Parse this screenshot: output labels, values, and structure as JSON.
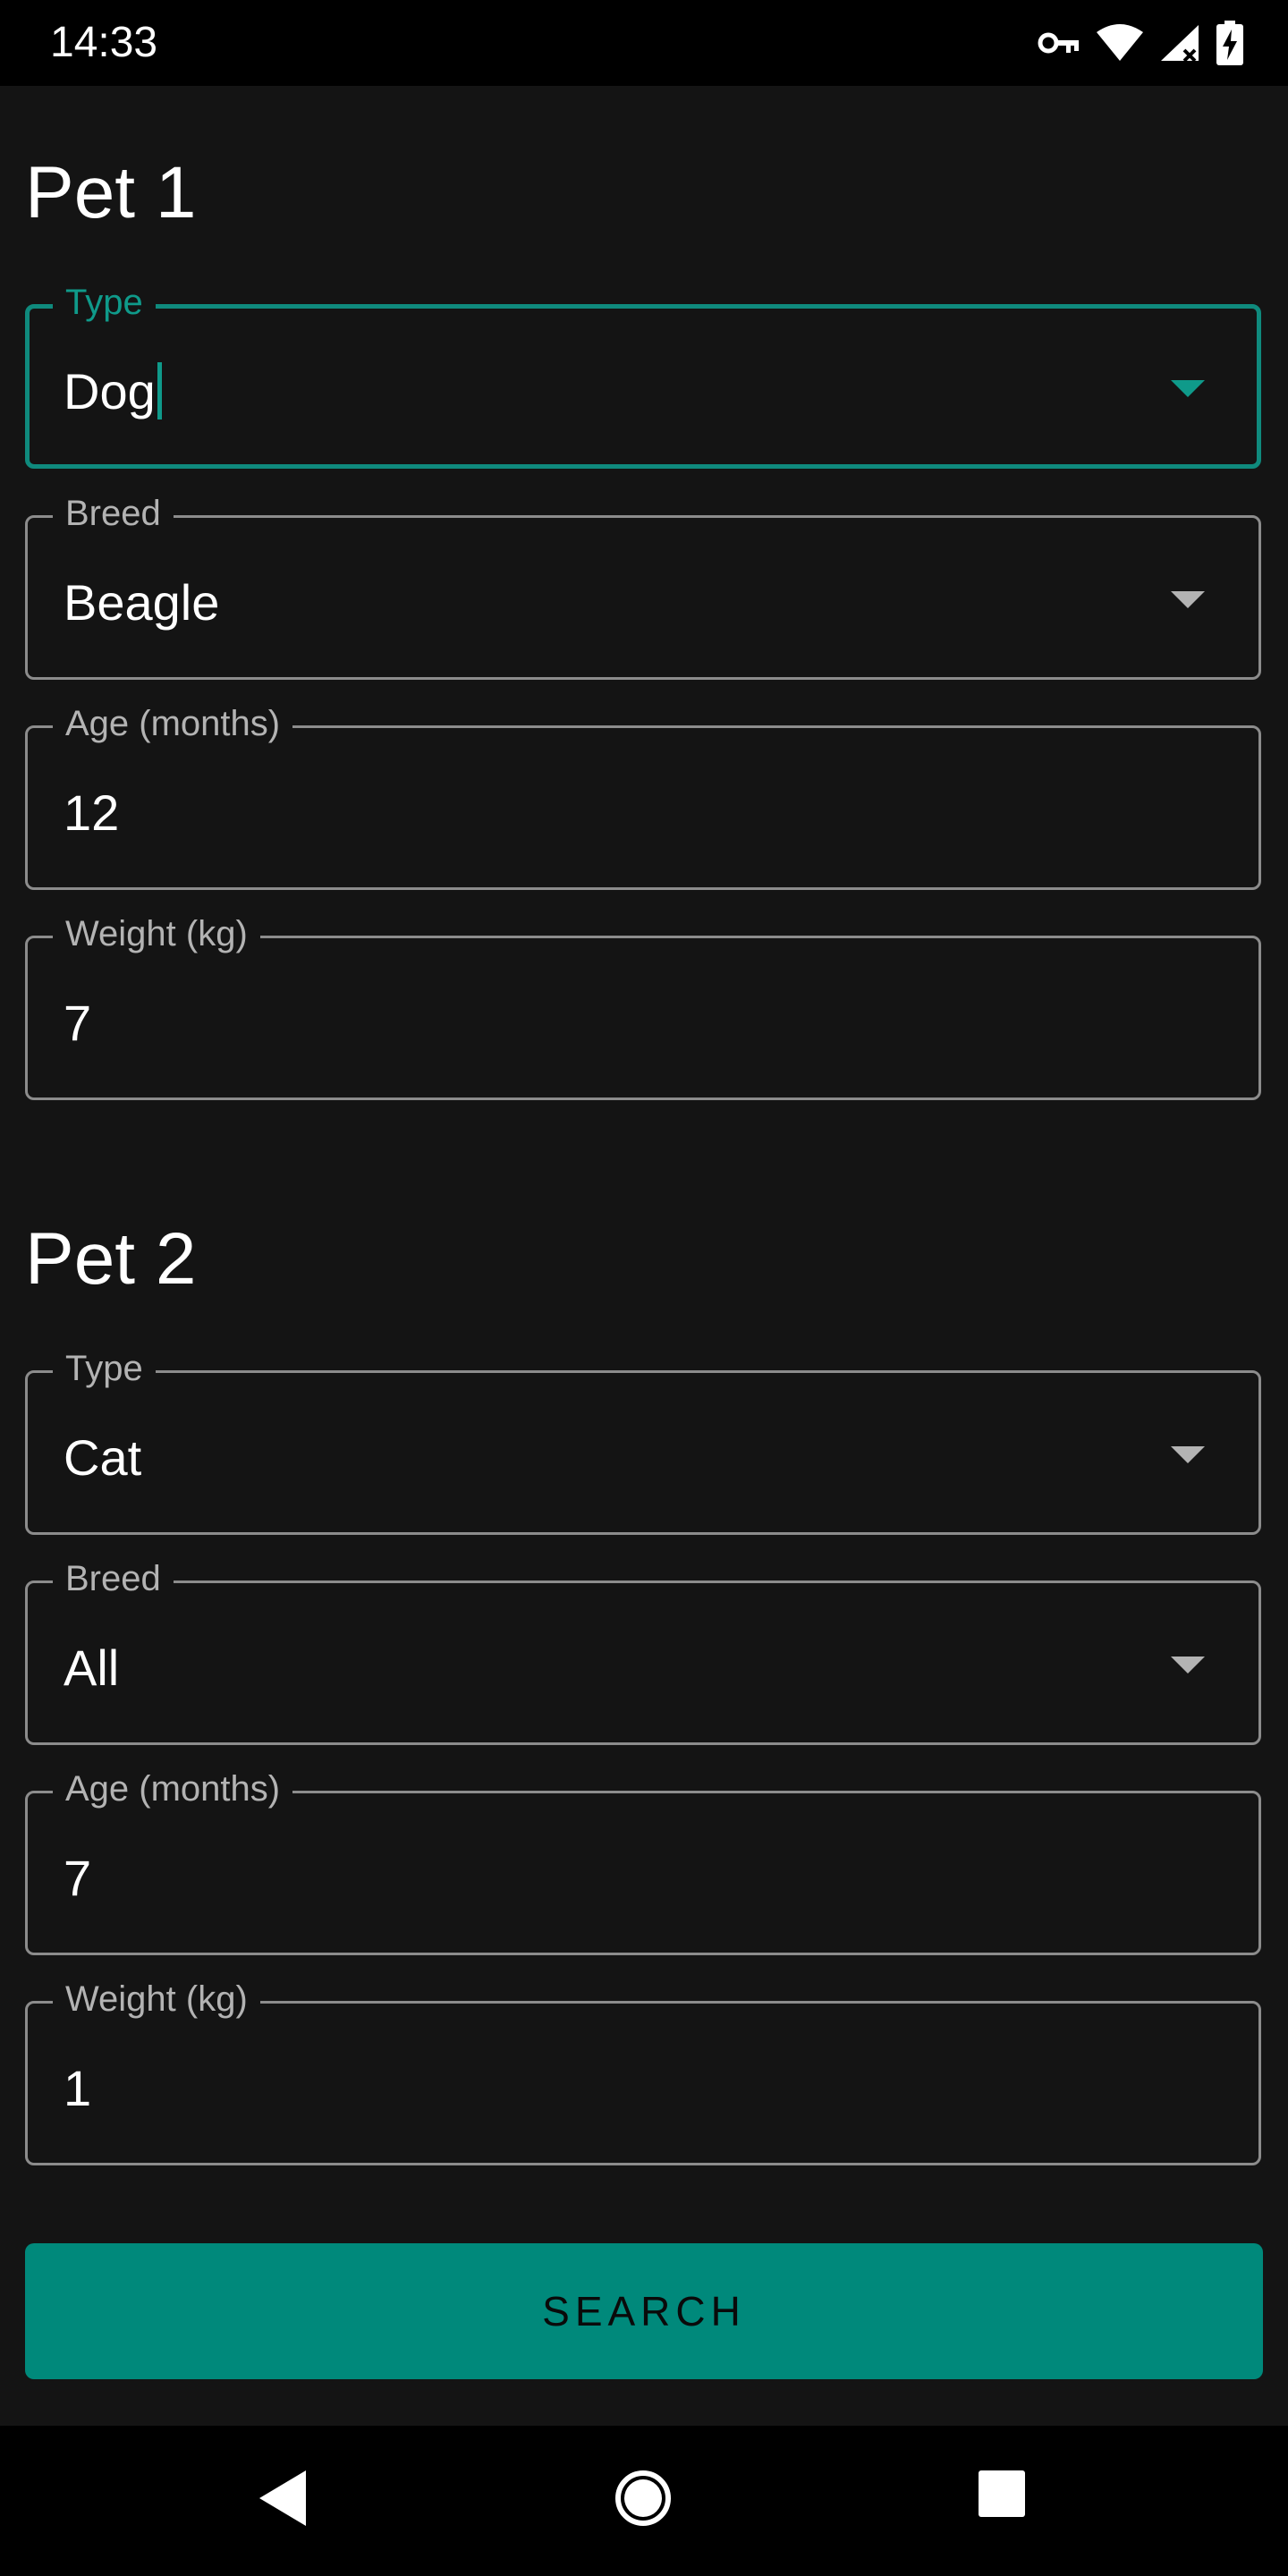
{
  "status_bar": {
    "time": "14:33",
    "icons": [
      "vpn-key-icon",
      "wifi-icon",
      "cell-signal-icon",
      "battery-charging-icon"
    ]
  },
  "pets": [
    {
      "title": "Pet 1",
      "type": {
        "label": "Type",
        "value": "Dog"
      },
      "breed": {
        "label": "Breed",
        "value": "Beagle"
      },
      "age": {
        "label": "Age (months)",
        "value": "12"
      },
      "weight": {
        "label": "Weight (kg)",
        "value": "7"
      }
    },
    {
      "title": "Pet 2",
      "type": {
        "label": "Type",
        "value": "Cat"
      },
      "breed": {
        "label": "Breed",
        "value": "All"
      },
      "age": {
        "label": "Age (months)",
        "value": "7"
      },
      "weight": {
        "label": "Weight (kg)",
        "value": "1"
      }
    }
  ],
  "search_button": {
    "label": "SEARCH"
  },
  "nav_bar": {
    "icons": [
      "back-icon",
      "home-icon",
      "recents-icon"
    ]
  },
  "colors": {
    "accent": "#00897b",
    "focus": "#0f8a7d",
    "background": "#141414",
    "outline": "#8c8c8c"
  }
}
